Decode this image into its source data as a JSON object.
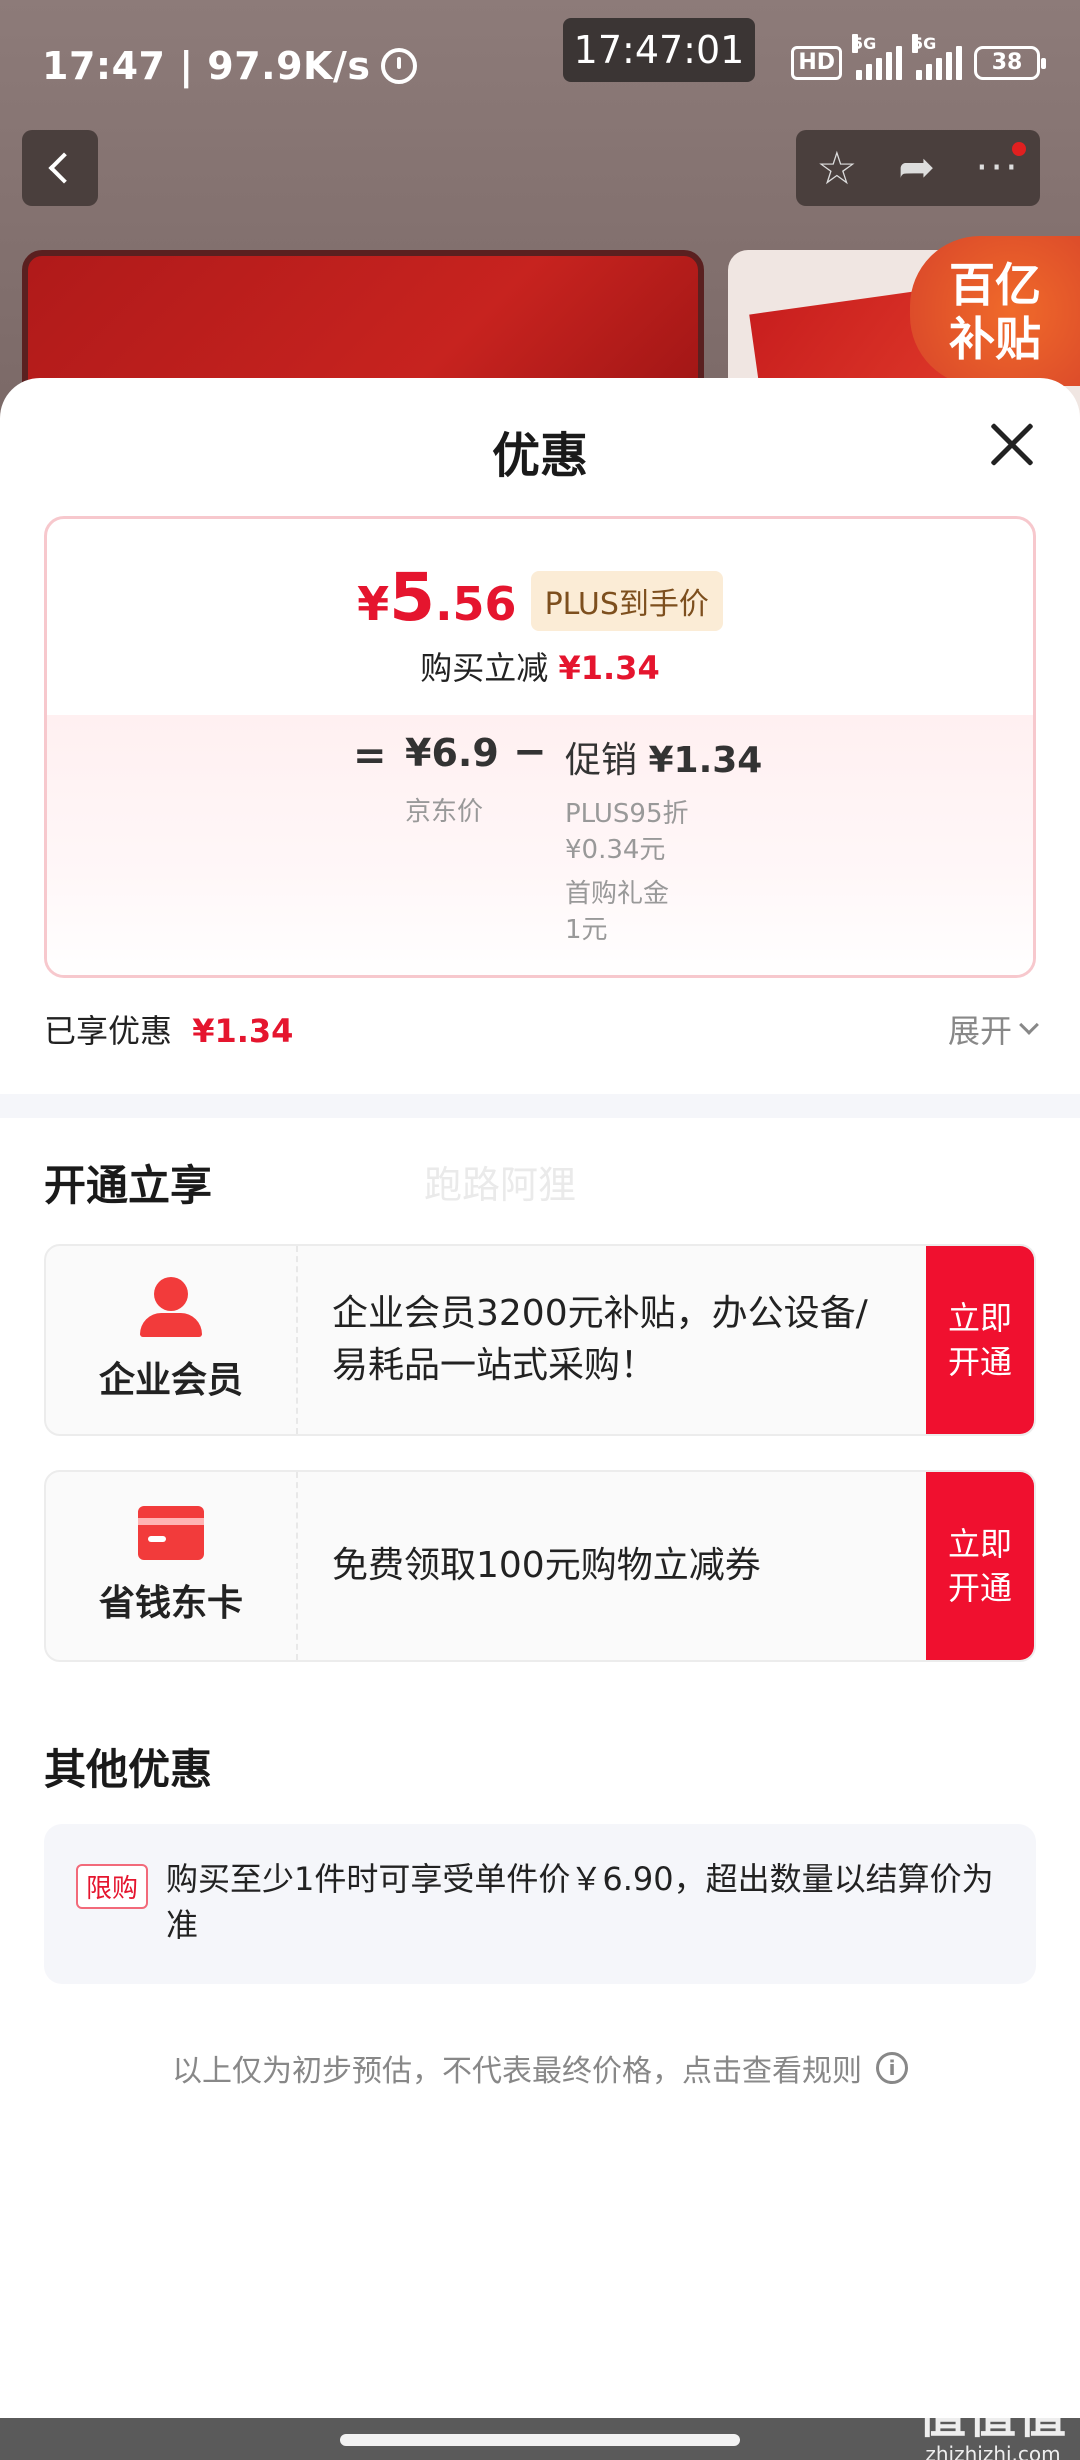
{
  "status_bar": {
    "left_text": "17:47 | 97.9K/s",
    "center_time": "17:47:01",
    "hd_label": "HD",
    "net1": "5G",
    "net2": "5G",
    "battery": "38"
  },
  "background_nav": {
    "subsidy_line1": "百亿",
    "subsidy_line2": "补贴"
  },
  "sheet": {
    "title": "优惠",
    "price_card": {
      "currency_symbol": "¥",
      "final_price_int": "5",
      "final_price_dec": ".56",
      "plus_label": "PLUS到手价",
      "reduce_label": "购买立减",
      "reduce_amount": "¥1.34",
      "equals": "=",
      "jd_price": "¥6.9",
      "jd_label": "京东价",
      "minus": "−",
      "promo_label": "促销",
      "promo_amount": "¥1.34",
      "promo_items": [
        "PLUS95折",
        "¥0.34元",
        "首购礼金",
        "1元"
      ]
    },
    "enjoyed_label": "已享优惠",
    "enjoyed_amount": "¥1.34",
    "expand_label": "展开",
    "open_section_title": "开通立享",
    "watermark": "跑路阿狸",
    "members": [
      {
        "name": "企业会员",
        "icon": "person-icon",
        "desc": "企业会员3200元补贴，办公设备/易耗品一站式采购！",
        "btn_line1": "立即",
        "btn_line2": "开通"
      },
      {
        "name": "省钱东卡",
        "icon": "card-icon",
        "desc": "免费领取100元购物立减券",
        "btn_line1": "立即",
        "btn_line2": "开通"
      }
    ],
    "other_section_title": "其他优惠",
    "other": {
      "tag": "限购",
      "text": "购买至少1件时可享受单件价￥6.90，超出数量以结算价为准"
    },
    "disclaimer": "以上仅为初步预估，不代表最终价格，点击查看规则",
    "info_icon_glyph": "i"
  },
  "corner_watermark": {
    "big": "值值值",
    "small": "zhizhizhi.com"
  },
  "colors": {
    "accent_red": "#e5152e",
    "button_red": "#f0102f",
    "plus_tag_bg": "#fbecd6"
  }
}
